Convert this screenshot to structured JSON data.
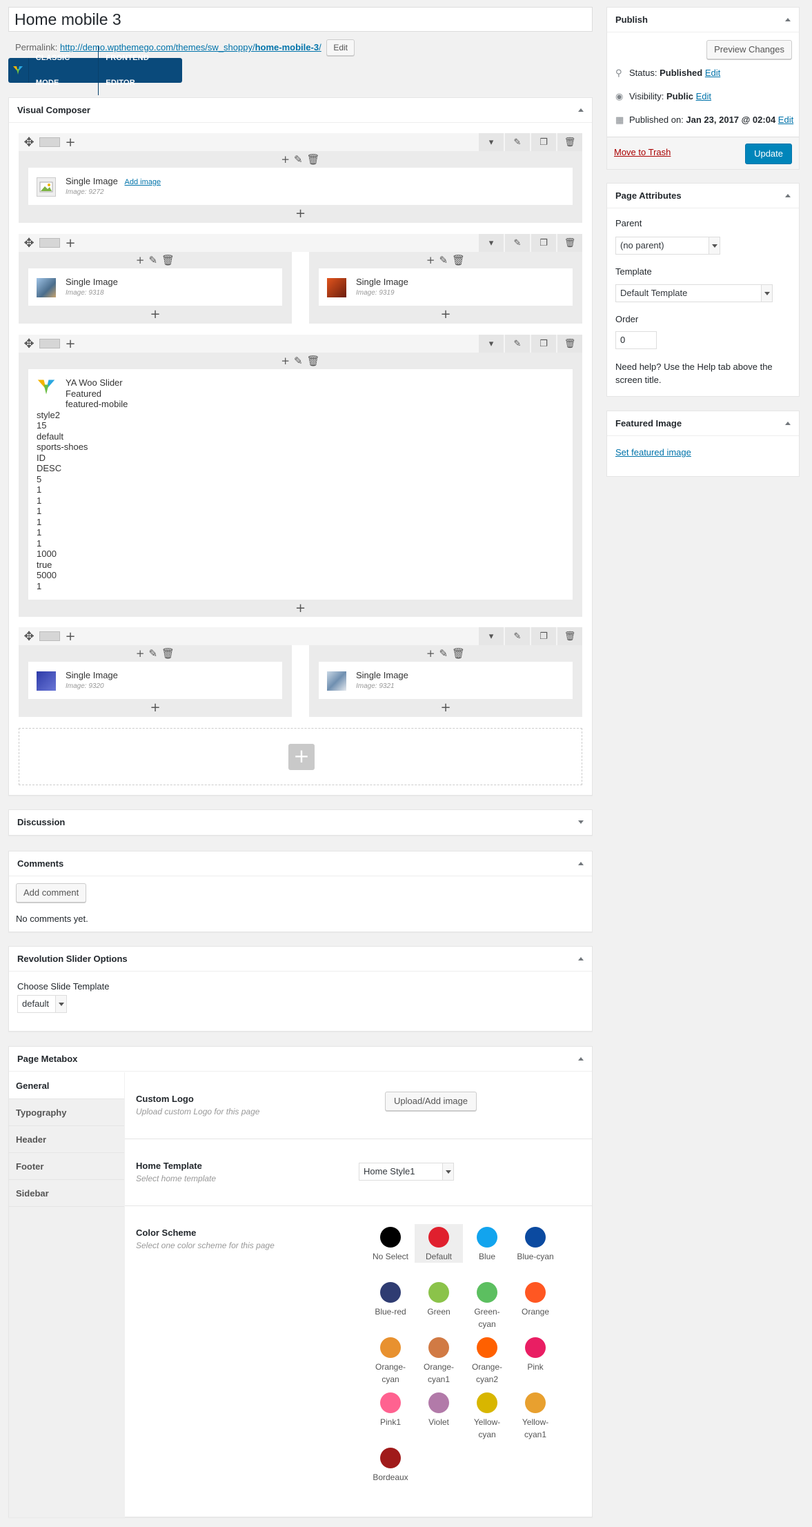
{
  "title": "Home mobile 3",
  "permalink": {
    "label": "Permalink:",
    "url_prefix": "http://demo.wpthemego.com/themes/sw_shoppy/",
    "url_slug": "home-mobile-3",
    "url_suffix": "/",
    "edit": "Edit"
  },
  "vc_bar": {
    "classic": "CLASSIC MODE",
    "frontend": "FRONTEND EDITOR"
  },
  "visual_composer": {
    "title": "Visual Composer",
    "rows": [
      {
        "elements": [
          {
            "name": "Single Image",
            "action": "Add image",
            "sub": "Image: 9272"
          }
        ]
      },
      {
        "elements": [
          {
            "name": "Single Image",
            "sub": "Image: 9318"
          },
          {
            "name": "Single Image",
            "sub": "Image: 9319"
          }
        ]
      },
      {
        "elements": [
          {
            "name": "YA Woo Slider",
            "lines": [
              "Featured",
              "featured-mobile",
              "style2",
              "15",
              "default",
              "sports-shoes",
              "ID",
              "DESC",
              "5",
              "1",
              "1",
              "1",
              "1",
              "1",
              "1",
              "1000",
              "true",
              "5000",
              "1"
            ]
          }
        ]
      },
      {
        "elements": [
          {
            "name": "Single Image",
            "sub": "Image: 9320"
          },
          {
            "name": "Single Image",
            "sub": "Image: 9321"
          }
        ]
      }
    ]
  },
  "discussion": {
    "title": "Discussion"
  },
  "comments": {
    "title": "Comments",
    "add": "Add comment",
    "empty": "No comments yet."
  },
  "rev_slider": {
    "title": "Revolution Slider Options",
    "label": "Choose Slide Template",
    "value": "default"
  },
  "metabox": {
    "title": "Page Metabox",
    "tabs": [
      "General",
      "Typography",
      "Header",
      "Footer",
      "Sidebar"
    ],
    "logo": {
      "label": "Custom Logo",
      "desc": "Upload custom Logo for this page",
      "button": "Upload/Add image"
    },
    "home": {
      "label": "Home Template",
      "desc": "Select home template",
      "value": "Home Style1"
    },
    "scheme": {
      "label": "Color Scheme",
      "desc": "Select one color scheme for this page",
      "options": [
        {
          "name": "No Select",
          "color": "#000000"
        },
        {
          "name": "Default",
          "color": "#e0202e",
          "selected": true
        },
        {
          "name": "Blue",
          "color": "#12a4ee"
        },
        {
          "name": "Blue-cyan",
          "color": "#0b4aa0"
        },
        {
          "name": "Blue-red",
          "color": "#2f3c72"
        },
        {
          "name": "Green",
          "color": "#8bc34a"
        },
        {
          "name": "Green-cyan",
          "color": "#5cbf60"
        },
        {
          "name": "Orange",
          "color": "#ff5722"
        },
        {
          "name": "Orange-cyan",
          "color": "#e8912f"
        },
        {
          "name": "Orange-cyan1",
          "color": "#d17a44"
        },
        {
          "name": "Orange-cyan2",
          "color": "#ff6000"
        },
        {
          "name": "Pink",
          "color": "#e91e63"
        },
        {
          "name": "Pink1",
          "color": "#ff6290"
        },
        {
          "name": "Violet",
          "color": "#b27aa9"
        },
        {
          "name": "Yellow-cyan",
          "color": "#d8b600"
        },
        {
          "name": "Yellow-cyan1",
          "color": "#e8a02f"
        },
        {
          "name": "Bordeaux",
          "color": "#a01a1a"
        }
      ]
    }
  },
  "publish": {
    "title": "Publish",
    "preview": "Preview Changes",
    "status_label": "Status:",
    "status": "Published",
    "visibility_label": "Visibility:",
    "visibility": "Public",
    "published_label": "Published on:",
    "published": "Jan 23, 2017 @ 02:04",
    "edit": "Edit",
    "trash": "Move to Trash",
    "update": "Update"
  },
  "attributes": {
    "title": "Page Attributes",
    "parent_label": "Parent",
    "parent": "(no parent)",
    "template_label": "Template",
    "template": "Default Template",
    "order_label": "Order",
    "order": "0",
    "help": "Need help? Use the Help tab above the screen title."
  },
  "featured": {
    "title": "Featured Image",
    "link": "Set featured image"
  }
}
